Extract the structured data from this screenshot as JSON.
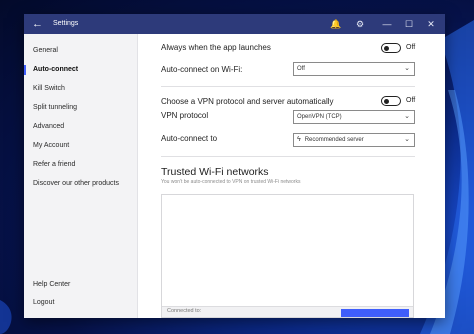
{
  "window": {
    "title": "Settings",
    "back_icon": "arrow-left-icon",
    "controls": [
      "bell-icon",
      "gear-icon",
      "minimize-icon",
      "maximize-icon",
      "close-icon"
    ]
  },
  "sidebar": {
    "items": [
      {
        "label": "General",
        "active": false
      },
      {
        "label": "Auto-connect",
        "active": true
      },
      {
        "label": "Kill Switch",
        "active": false
      },
      {
        "label": "Split tunneling",
        "active": false
      },
      {
        "label": "Advanced",
        "active": false
      },
      {
        "label": "My Account",
        "active": false
      },
      {
        "label": "Refer a friend",
        "active": false
      },
      {
        "label": "Discover our other products",
        "active": false
      }
    ],
    "bottom_items": [
      {
        "label": "Help Center"
      },
      {
        "label": "Logout"
      }
    ]
  },
  "settings": {
    "launch": {
      "label": "Always when the app launches",
      "toggle": "Off"
    },
    "wifi": {
      "label": "Auto-connect on Wi-Fi:",
      "value": "Off"
    },
    "choose": {
      "label": "Choose a VPN protocol and server automatically",
      "toggle": "Off"
    },
    "protocol": {
      "label": "VPN protocol",
      "value": "OpenVPN (TCP)"
    },
    "autoconnect_to": {
      "label": "Auto-connect to",
      "value": "Recommended server",
      "icon": "lightning-bolt-icon"
    }
  },
  "trusted": {
    "title": "Trusted Wi-Fi networks",
    "subtitle": "You won't be auto-connected to VPN on trusted Wi-Fi networks",
    "footer_label": "Connected to:"
  },
  "colors": {
    "titlebar": "#2d3a7a",
    "accent": "#3f5efb",
    "desktop": "#0b2a8a"
  }
}
